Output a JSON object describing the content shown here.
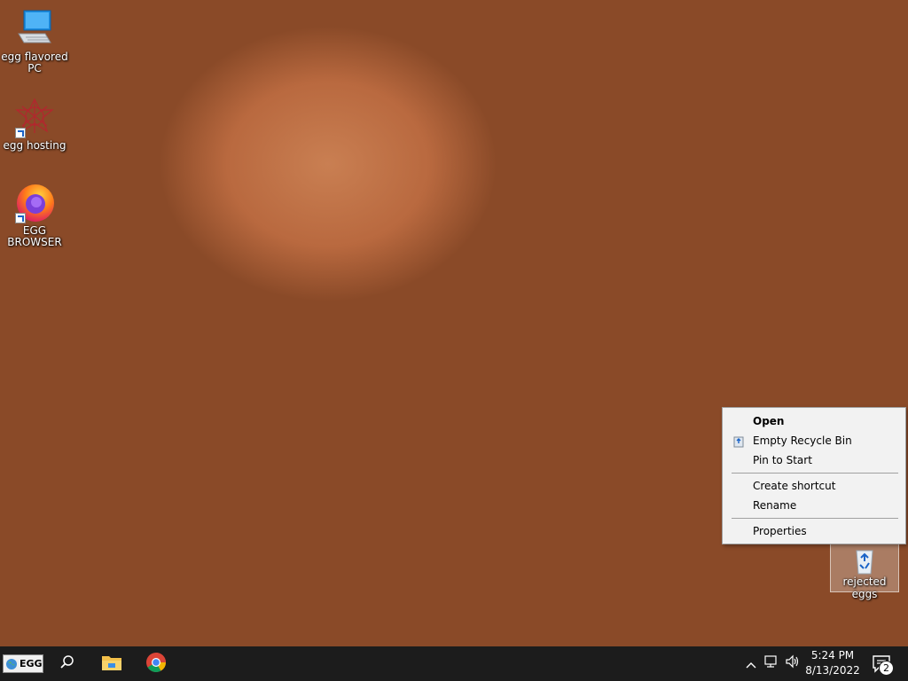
{
  "desktop": {
    "icons": [
      {
        "label": "egg flavored PC",
        "icon": "computer-icon"
      },
      {
        "label": "egg hosting",
        "icon": "web-hosting-icon"
      },
      {
        "label": "EGG BROWSER",
        "icon": "firefox-icon"
      }
    ],
    "recycle_bin": {
      "label": "rejected eggs",
      "icon": "recycle-bin-icon"
    }
  },
  "context_menu": {
    "items": [
      {
        "label": "Open",
        "bold": true
      },
      {
        "label": "Empty Recycle Bin",
        "icon": "recycle-icon"
      },
      {
        "label": "Pin to Start"
      },
      {
        "label": "Create shortcut"
      },
      {
        "label": "Rename"
      },
      {
        "label": "Properties"
      }
    ]
  },
  "taskbar": {
    "start_label": "EGG",
    "pinned": [
      "search-icon",
      "file-explorer-icon",
      "chrome-icon"
    ],
    "clock": {
      "time": "5:24 PM",
      "date": "8/13/2022"
    },
    "notifications_count": "2",
    "colors": {
      "background": "#1c1c1c",
      "accent": "#1a63c7"
    }
  }
}
